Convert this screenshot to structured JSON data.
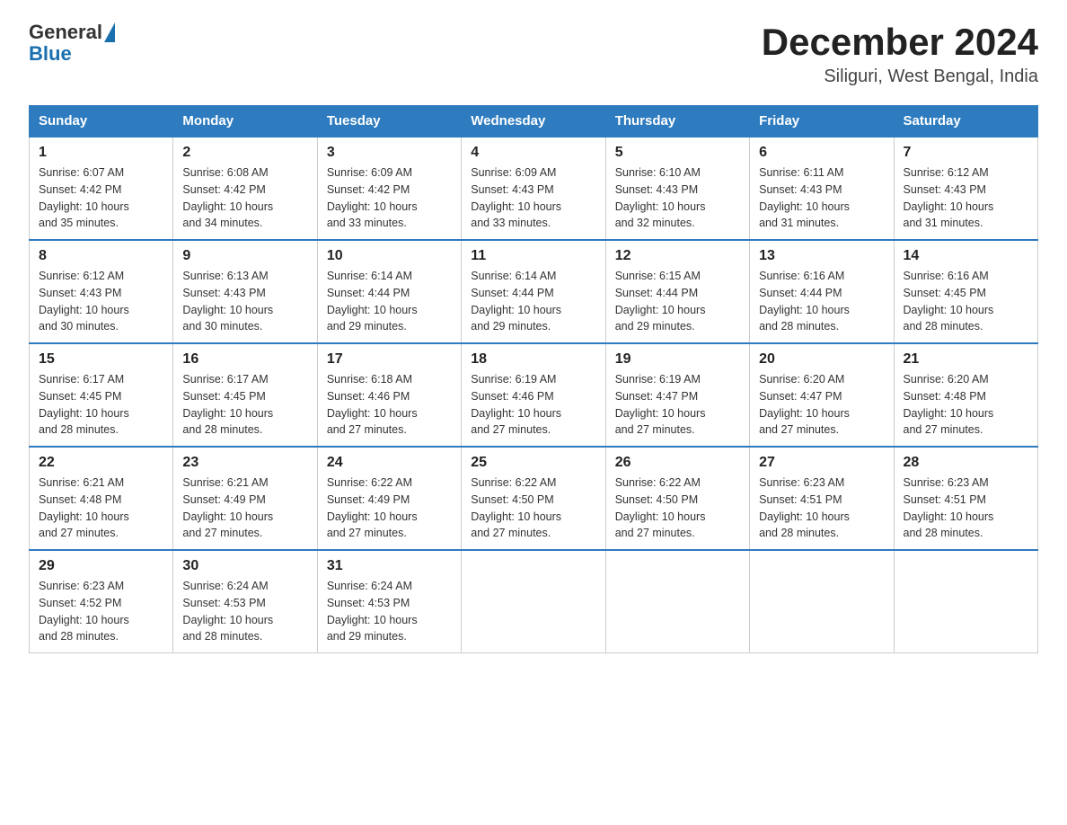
{
  "header": {
    "logo_general": "General",
    "logo_blue": "Blue",
    "month_year": "December 2024",
    "location": "Siliguri, West Bengal, India"
  },
  "days_of_week": [
    "Sunday",
    "Monday",
    "Tuesday",
    "Wednesday",
    "Thursday",
    "Friday",
    "Saturday"
  ],
  "weeks": [
    [
      {
        "day": "1",
        "sunrise": "6:07 AM",
        "sunset": "4:42 PM",
        "daylight": "10 hours and 35 minutes."
      },
      {
        "day": "2",
        "sunrise": "6:08 AM",
        "sunset": "4:42 PM",
        "daylight": "10 hours and 34 minutes."
      },
      {
        "day": "3",
        "sunrise": "6:09 AM",
        "sunset": "4:42 PM",
        "daylight": "10 hours and 33 minutes."
      },
      {
        "day": "4",
        "sunrise": "6:09 AM",
        "sunset": "4:43 PM",
        "daylight": "10 hours and 33 minutes."
      },
      {
        "day": "5",
        "sunrise": "6:10 AM",
        "sunset": "4:43 PM",
        "daylight": "10 hours and 32 minutes."
      },
      {
        "day": "6",
        "sunrise": "6:11 AM",
        "sunset": "4:43 PM",
        "daylight": "10 hours and 31 minutes."
      },
      {
        "day": "7",
        "sunrise": "6:12 AM",
        "sunset": "4:43 PM",
        "daylight": "10 hours and 31 minutes."
      }
    ],
    [
      {
        "day": "8",
        "sunrise": "6:12 AM",
        "sunset": "4:43 PM",
        "daylight": "10 hours and 30 minutes."
      },
      {
        "day": "9",
        "sunrise": "6:13 AM",
        "sunset": "4:43 PM",
        "daylight": "10 hours and 30 minutes."
      },
      {
        "day": "10",
        "sunrise": "6:14 AM",
        "sunset": "4:44 PM",
        "daylight": "10 hours and 29 minutes."
      },
      {
        "day": "11",
        "sunrise": "6:14 AM",
        "sunset": "4:44 PM",
        "daylight": "10 hours and 29 minutes."
      },
      {
        "day": "12",
        "sunrise": "6:15 AM",
        "sunset": "4:44 PM",
        "daylight": "10 hours and 29 minutes."
      },
      {
        "day": "13",
        "sunrise": "6:16 AM",
        "sunset": "4:44 PM",
        "daylight": "10 hours and 28 minutes."
      },
      {
        "day": "14",
        "sunrise": "6:16 AM",
        "sunset": "4:45 PM",
        "daylight": "10 hours and 28 minutes."
      }
    ],
    [
      {
        "day": "15",
        "sunrise": "6:17 AM",
        "sunset": "4:45 PM",
        "daylight": "10 hours and 28 minutes."
      },
      {
        "day": "16",
        "sunrise": "6:17 AM",
        "sunset": "4:45 PM",
        "daylight": "10 hours and 28 minutes."
      },
      {
        "day": "17",
        "sunrise": "6:18 AM",
        "sunset": "4:46 PM",
        "daylight": "10 hours and 27 minutes."
      },
      {
        "day": "18",
        "sunrise": "6:19 AM",
        "sunset": "4:46 PM",
        "daylight": "10 hours and 27 minutes."
      },
      {
        "day": "19",
        "sunrise": "6:19 AM",
        "sunset": "4:47 PM",
        "daylight": "10 hours and 27 minutes."
      },
      {
        "day": "20",
        "sunrise": "6:20 AM",
        "sunset": "4:47 PM",
        "daylight": "10 hours and 27 minutes."
      },
      {
        "day": "21",
        "sunrise": "6:20 AM",
        "sunset": "4:48 PM",
        "daylight": "10 hours and 27 minutes."
      }
    ],
    [
      {
        "day": "22",
        "sunrise": "6:21 AM",
        "sunset": "4:48 PM",
        "daylight": "10 hours and 27 minutes."
      },
      {
        "day": "23",
        "sunrise": "6:21 AM",
        "sunset": "4:49 PM",
        "daylight": "10 hours and 27 minutes."
      },
      {
        "day": "24",
        "sunrise": "6:22 AM",
        "sunset": "4:49 PM",
        "daylight": "10 hours and 27 minutes."
      },
      {
        "day": "25",
        "sunrise": "6:22 AM",
        "sunset": "4:50 PM",
        "daylight": "10 hours and 27 minutes."
      },
      {
        "day": "26",
        "sunrise": "6:22 AM",
        "sunset": "4:50 PM",
        "daylight": "10 hours and 27 minutes."
      },
      {
        "day": "27",
        "sunrise": "6:23 AM",
        "sunset": "4:51 PM",
        "daylight": "10 hours and 28 minutes."
      },
      {
        "day": "28",
        "sunrise": "6:23 AM",
        "sunset": "4:51 PM",
        "daylight": "10 hours and 28 minutes."
      }
    ],
    [
      {
        "day": "29",
        "sunrise": "6:23 AM",
        "sunset": "4:52 PM",
        "daylight": "10 hours and 28 minutes."
      },
      {
        "day": "30",
        "sunrise": "6:24 AM",
        "sunset": "4:53 PM",
        "daylight": "10 hours and 28 minutes."
      },
      {
        "day": "31",
        "sunrise": "6:24 AM",
        "sunset": "4:53 PM",
        "daylight": "10 hours and 29 minutes."
      },
      null,
      null,
      null,
      null
    ]
  ],
  "labels": {
    "sunrise": "Sunrise:",
    "sunset": "Sunset:",
    "daylight": "Daylight:"
  }
}
